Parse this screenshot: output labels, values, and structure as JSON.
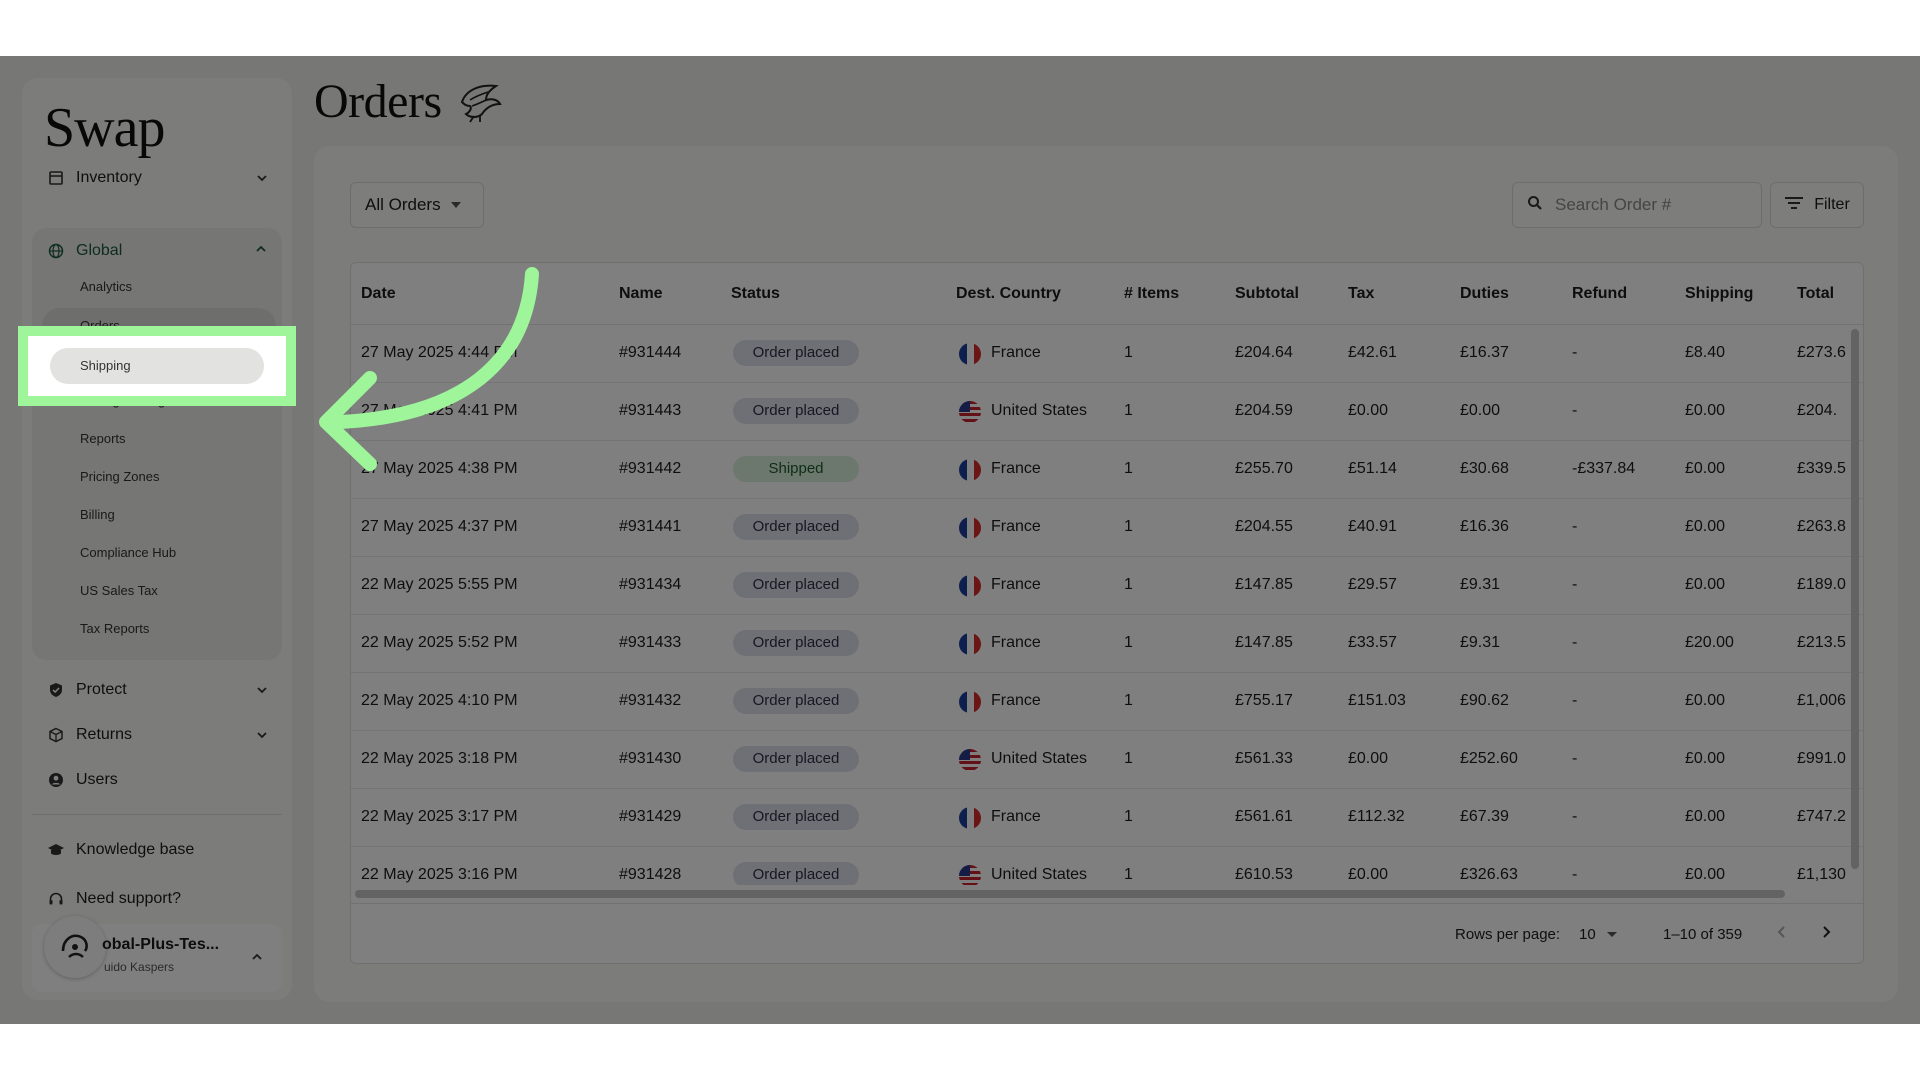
{
  "app": {
    "logo": "Swap"
  },
  "sidebar": {
    "inventory": "Inventory",
    "global": "Global",
    "global_items": [
      "Analytics",
      "Orders",
      "Shipping",
      "Pricing Strategies Lab",
      "Reports",
      "Pricing Zones",
      "Billing",
      "Compliance Hub",
      "US Sales Tax",
      "Tax Reports"
    ],
    "protect": "Protect",
    "returns": "Returns",
    "users": "Users",
    "knowledge_base": "Knowledge base",
    "need_support": "Need support?",
    "account": {
      "name": "obal-Plus-Tes...",
      "user": "uido Kaspers"
    }
  },
  "page": {
    "title": "Orders"
  },
  "toolbar": {
    "orders_filter": "All Orders",
    "search_placeholder": "Search Order #",
    "filter_label": "Filter"
  },
  "table": {
    "columns": [
      "Date",
      "Name",
      "Status",
      "Dest. Country",
      "# Items",
      "Subtotal",
      "Tax",
      "Duties",
      "Refund",
      "Shipping",
      "Total"
    ],
    "rows": [
      {
        "date": "27 May 2025 4:44 PM",
        "name": "#931444",
        "status": "Order placed",
        "country": "France",
        "flag": "fr",
        "items": "1",
        "subtotal": "£204.64",
        "tax": "£42.61",
        "duties": "£16.37",
        "refund": "-",
        "shipping": "£8.40",
        "total": "£273.6"
      },
      {
        "date": "27 May 2025 4:41 PM",
        "name": "#931443",
        "status": "Order placed",
        "country": "United States",
        "flag": "us",
        "items": "1",
        "subtotal": "£204.59",
        "tax": "£0.00",
        "duties": "£0.00",
        "refund": "-",
        "shipping": "£0.00",
        "total": "£204."
      },
      {
        "date": "27 May 2025 4:38 PM",
        "name": "#931442",
        "status": "Shipped",
        "country": "France",
        "flag": "fr",
        "items": "1",
        "subtotal": "£255.70",
        "tax": "£51.14",
        "duties": "£30.68",
        "refund": "-£337.84",
        "shipping": "£0.00",
        "total": "£339.5"
      },
      {
        "date": "27 May 2025 4:37 PM",
        "name": "#931441",
        "status": "Order placed",
        "country": "France",
        "flag": "fr",
        "items": "1",
        "subtotal": "£204.55",
        "tax": "£40.91",
        "duties": "£16.36",
        "refund": "-",
        "shipping": "£0.00",
        "total": "£263.8"
      },
      {
        "date": "22 May 2025 5:55 PM",
        "name": "#931434",
        "status": "Order placed",
        "country": "France",
        "flag": "fr",
        "items": "1",
        "subtotal": "£147.85",
        "tax": "£29.57",
        "duties": "£9.31",
        "refund": "-",
        "shipping": "£0.00",
        "total": "£189.0"
      },
      {
        "date": "22 May 2025 5:52 PM",
        "name": "#931433",
        "status": "Order placed",
        "country": "France",
        "flag": "fr",
        "items": "1",
        "subtotal": "£147.85",
        "tax": "£33.57",
        "duties": "£9.31",
        "refund": "-",
        "shipping": "£20.00",
        "total": "£213.5"
      },
      {
        "date": "22 May 2025 4:10 PM",
        "name": "#931432",
        "status": "Order placed",
        "country": "France",
        "flag": "fr",
        "items": "1",
        "subtotal": "£755.17",
        "tax": "£151.03",
        "duties": "£90.62",
        "refund": "-",
        "shipping": "£0.00",
        "total": "£1,006"
      },
      {
        "date": "22 May 2025 3:18 PM",
        "name": "#931430",
        "status": "Order placed",
        "country": "United States",
        "flag": "us",
        "items": "1",
        "subtotal": "£561.33",
        "tax": "£0.00",
        "duties": "£252.60",
        "refund": "-",
        "shipping": "£0.00",
        "total": "£991.0"
      },
      {
        "date": "22 May 2025 3:17 PM",
        "name": "#931429",
        "status": "Order placed",
        "country": "France",
        "flag": "fr",
        "items": "1",
        "subtotal": "£561.61",
        "tax": "£112.32",
        "duties": "£67.39",
        "refund": "-",
        "shipping": "£0.00",
        "total": "£747.2"
      },
      {
        "date": "22 May 2025 3:16 PM",
        "name": "#931428",
        "status": "Order placed",
        "country": "United States",
        "flag": "us",
        "items": "1",
        "subtotal": "£610.53",
        "tax": "£0.00",
        "duties": "£326.63",
        "refund": "-",
        "shipping": "£0.00",
        "total": "£1,130"
      }
    ]
  },
  "pagination": {
    "rows_label": "Rows per page:",
    "rows_value": "10",
    "range": "1–10 of 359"
  },
  "colors": {
    "highlight": "#9ef59a",
    "shipped_bg": "#d9eedb",
    "placed_bg": "#dfe1ea",
    "global_accent": "#1d5a3a"
  }
}
